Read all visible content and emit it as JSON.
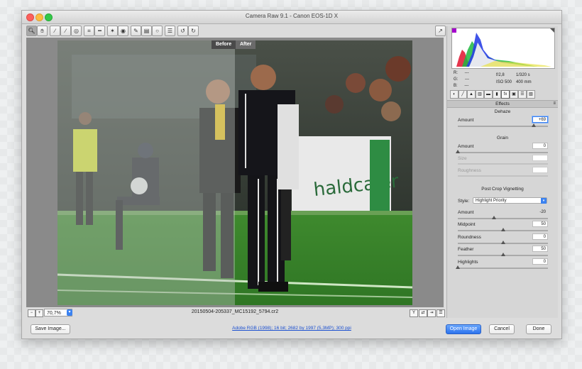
{
  "window": {
    "title": "Camera Raw 9.1  -  Canon EOS-1D X"
  },
  "toolbar": {
    "tools": [
      "zoom-tool",
      "hand-tool",
      "white-balance-tool",
      "color-sampler-tool",
      "targeted-adjustment-tool",
      "crop-tool",
      "straighten-tool",
      "spot-removal-tool",
      "red-eye-tool",
      "adjustment-brush",
      "graduated-filter",
      "radial-filter",
      "open-preferences",
      "rotate-ccw",
      "rotate-cw"
    ],
    "fullscreen": "fullscreen-icon"
  },
  "preview": {
    "before_label": "Before",
    "after_label": "After"
  },
  "status": {
    "zoom": "70,7%",
    "filename": "20150504-205337_MC15192_5794.cr2"
  },
  "info": {
    "r_label": "R:",
    "g_label": "G:",
    "b_label": "B:",
    "r_val": "---",
    "g_val": "---",
    "b_val": "---",
    "aperture": "f/2,8",
    "shutter": "1/320 s",
    "iso": "ISO 500",
    "focal": "400 mm"
  },
  "panel": {
    "section": "Effects",
    "dehaze": {
      "title": "Dehaze",
      "amount_label": "Amount",
      "amount": "+69",
      "amount_level": 0.845
    },
    "grain": {
      "title": "Grain",
      "amount_label": "Amount",
      "amount": "0",
      "amount_level": 0.0,
      "size_label": "Size",
      "roughness_label": "Roughness"
    },
    "vignette": {
      "title": "Post Crop Vignetting",
      "style_label": "Style:",
      "style": "Highlight Priority",
      "amount_label": "Amount",
      "amount": "-20",
      "amount_level": 0.4,
      "midpoint_label": "Midpoint",
      "midpoint": "50",
      "midpoint_level": 0.5,
      "roundness_label": "Roundness",
      "roundness": "0",
      "roundness_level": 0.5,
      "feather_label": "Feather",
      "feather": "50",
      "feather_level": 0.5,
      "highlights_label": "Highlights",
      "highlights": "0",
      "highlights_level": 0.0
    }
  },
  "footer": {
    "save": "Save Image...",
    "workflow": "Adobe RGB (1998); 16 bit; 2682 by 1997 (5,3MP); 300 ppi",
    "open": "Open Image",
    "cancel": "Cancel",
    "done": "Done"
  },
  "colors": {
    "accent": "#3b82f0",
    "field": "#3f8a2e"
  }
}
